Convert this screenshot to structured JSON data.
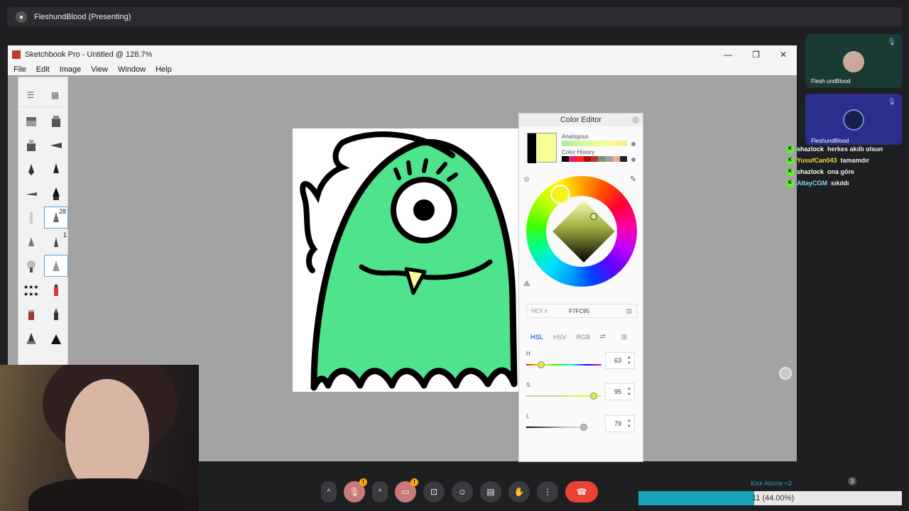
{
  "meet": {
    "presenter_title": "FleshundBlood (Presenting)",
    "participants": [
      {
        "name": "Flesh undBlood"
      },
      {
        "name": "FleshundBlood"
      }
    ],
    "controls": {
      "mic": "mic-off",
      "cam": "cam-off",
      "present": "present",
      "emoji": "emoji",
      "captions": "captions",
      "hand": "raise-hand",
      "more": "more",
      "end": "end-call",
      "warn": "!",
      "more_glyph": "⋮",
      "caret": "^"
    },
    "count_badge": "3"
  },
  "chat": [
    {
      "user": "shazlock",
      "msg": "herkes akıllı olsun",
      "color": "#ffffff"
    },
    {
      "user": "YusufCan043",
      "msg": "tamamdır",
      "color": "#f5d55a"
    },
    {
      "user": "shazlock",
      "msg": "ona göre",
      "color": "#ffffff"
    },
    {
      "user": "AltayCGM",
      "msg": "sıkıldı",
      "color": "#7fd4ff"
    }
  ],
  "goal": {
    "label": "Kick Abone <3",
    "text": "11 (44.00%)",
    "progress": 0.44
  },
  "app": {
    "title": "Sketchbook Pro - Untitled @ 128.7%",
    "menu": [
      "File",
      "Edit",
      "Image",
      "View",
      "Window",
      "Help"
    ],
    "tool_badges": {
      "a": "28",
      "b": "1"
    }
  },
  "color_editor": {
    "title": "Color Editor",
    "analogous_label": "Analogous",
    "history_label": "Color History",
    "history": [
      "#000000",
      "#e0187a",
      "#ff2020",
      "#a01010",
      "#c03030",
      "#709a70",
      "#a0a0a0",
      "#e8b090",
      "#222222"
    ],
    "hex_label": "HEX #",
    "hex_value": "F7FC95",
    "current_color": "#F7FC95",
    "modes": [
      "HSL",
      "HSV",
      "RGB"
    ],
    "active_mode": "HSL",
    "sliders": [
      {
        "label": "H",
        "value": "63",
        "pos": 0.2
      },
      {
        "label": "S",
        "value": "95",
        "pos": 0.9
      },
      {
        "label": "L",
        "value": "79",
        "pos": 0.76
      }
    ]
  }
}
